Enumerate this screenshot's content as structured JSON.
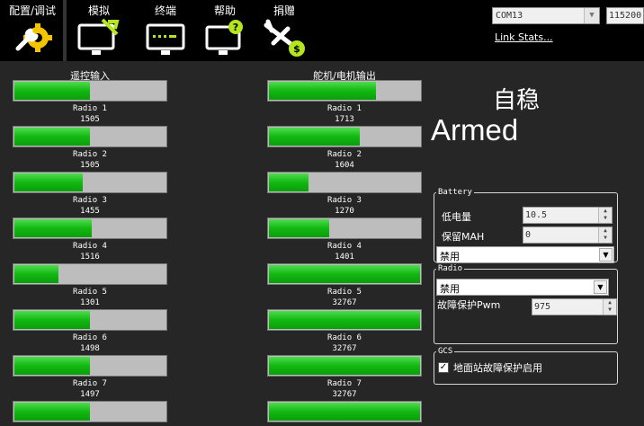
{
  "toolbar": {
    "menu": [
      {
        "label": "配置/调试",
        "icon": "wrench-gear-icon"
      },
      {
        "label": "模拟",
        "icon": "monitor-plane-icon"
      },
      {
        "label": "终端",
        "icon": "terminal-monitor-icon"
      },
      {
        "label": "帮助",
        "icon": "help-monitor-icon"
      },
      {
        "label": "捐赠",
        "icon": "donate-plane-icon"
      }
    ],
    "port": "COM13",
    "baud": "115200",
    "link_stats": "Link Stats..."
  },
  "radio_in": {
    "title": "遥控输入",
    "channels": [
      {
        "name": "Radio 1",
        "value": "1505",
        "level": 0.5
      },
      {
        "name": "Radio 2",
        "value": "1505",
        "level": 0.5
      },
      {
        "name": "Radio 3",
        "value": "1455",
        "level": 0.45
      },
      {
        "name": "Radio 4",
        "value": "1516",
        "level": 0.51
      },
      {
        "name": "Radio 5",
        "value": "1301",
        "level": 0.29
      },
      {
        "name": "Radio 6",
        "value": "1498",
        "level": 0.5
      },
      {
        "name": "Radio 7",
        "value": "1497",
        "level": 0.5
      },
      {
        "name": "",
        "value": "",
        "level": 0.5
      }
    ]
  },
  "servo_out": {
    "title": "舵机/电机输出",
    "channels": [
      {
        "name": "Radio 1",
        "value": "1713",
        "level": 0.71
      },
      {
        "name": "Radio 2",
        "value": "1604",
        "level": 0.6
      },
      {
        "name": "Radio 3",
        "value": "1270",
        "level": 0.26
      },
      {
        "name": "Radio 4",
        "value": "1401",
        "level": 0.4
      },
      {
        "name": "Radio 5",
        "value": "32767",
        "level": 1.0
      },
      {
        "name": "Radio 6",
        "value": "32767",
        "level": 1.0
      },
      {
        "name": "Radio 7",
        "value": "32767",
        "level": 1.0
      },
      {
        "name": "",
        "value": "",
        "level": 1.0
      }
    ]
  },
  "status": {
    "mode": "自稳",
    "armed": "Armed"
  },
  "battery": {
    "legend": "Battery",
    "low_voltage_label": "低电量",
    "low_voltage_value": "10.5",
    "reserve_mah_label": "保留MAH",
    "reserve_mah_value": "0",
    "action": "禁用"
  },
  "radio": {
    "legend": "Radio",
    "action": "禁用",
    "failsafe_pwm_label": "故障保护Pwm",
    "failsafe_pwm_value": "975"
  },
  "gcs": {
    "legend": "GCS",
    "failsafe_label": "地面站故障保护启用",
    "checked": true
  }
}
